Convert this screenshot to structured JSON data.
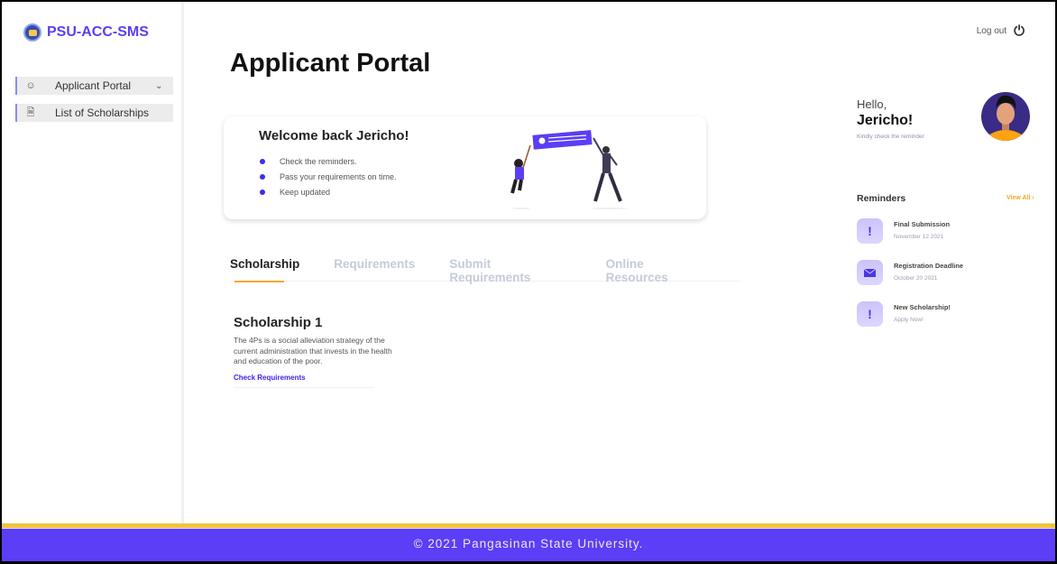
{
  "brand": {
    "name": "PSU-ACC-SMS"
  },
  "sidebar": {
    "items": [
      {
        "label": "Applicant Portal",
        "icon": "user-icon",
        "has_dropdown": true
      },
      {
        "label": "List of Scholarships",
        "icon": "document-icon"
      }
    ]
  },
  "header": {
    "title": "Applicant Portal",
    "logout_label": "Log out"
  },
  "welcome": {
    "title": "Welcome back Jericho!",
    "items": [
      "Check the reminders.",
      "Pass your requirements on time.",
      "Keep updated"
    ]
  },
  "tabs": [
    {
      "label": "Scholarship",
      "active": true
    },
    {
      "label": "Requirements"
    },
    {
      "label": "Submit Requirements"
    },
    {
      "label": "Online Resources"
    }
  ],
  "scholarship": {
    "title": "Scholarship 1",
    "description": "The 4Ps is a social alleviation strategy of the current administration that invests in the health and education of the poor.",
    "link": "Check Requirements"
  },
  "greeting": {
    "hello": "Hello,",
    "name": "Jericho!",
    "subtitle": "Kindly check the reminder"
  },
  "reminders": {
    "title": "Reminders",
    "view_all": "View All",
    "items": [
      {
        "title": "Final Submission",
        "subtitle": "November 12 2021",
        "icon": "exclamation-icon"
      },
      {
        "title": "Registration Deadline",
        "subtitle": "October 20 2021",
        "icon": "mail-icon"
      },
      {
        "title": "New Scholarship!",
        "subtitle": "Apply Now!",
        "icon": "exclamation-icon"
      }
    ]
  },
  "footer": {
    "text": "© 2021 Pangasinan State University."
  },
  "colors": {
    "accent": "#5b3ef5",
    "tab_underline": "#f6a623",
    "footer_stripe": "#f2c33d"
  }
}
